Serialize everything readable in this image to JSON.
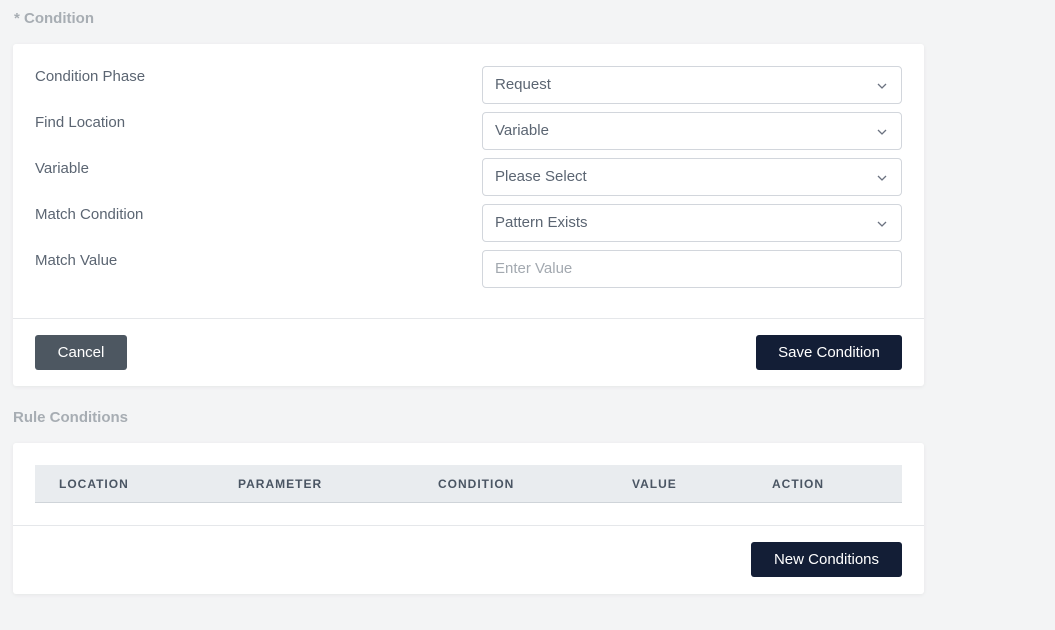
{
  "condition_section": {
    "title": "* Condition",
    "fields": [
      {
        "label": "Condition Phase",
        "value": "Request",
        "type": "select"
      },
      {
        "label": "Find Location",
        "value": "Variable",
        "type": "select"
      },
      {
        "label": "Variable",
        "value": "Please Select",
        "type": "select"
      },
      {
        "label": "Match Condition",
        "value": "Pattern Exists",
        "type": "select"
      },
      {
        "label": "Match Value",
        "placeholder": "Enter Value",
        "value": "",
        "type": "input"
      }
    ],
    "cancel_label": "Cancel",
    "save_label": "Save Condition"
  },
  "rule_conditions": {
    "title": "Rule Conditions",
    "columns": [
      "LOCATION",
      "PARAMETER",
      "CONDITION",
      "VALUE",
      "ACTION"
    ],
    "rows": [],
    "new_label": "New Conditions"
  },
  "icons": {
    "dropdown": "chevron-down-icon"
  }
}
